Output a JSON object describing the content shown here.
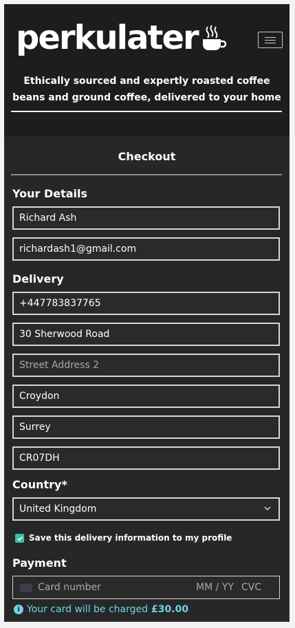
{
  "header": {
    "logo_text": "perkulater",
    "tagline": "Ethically sourced and expertly roasted coffee beans and ground coffee, delivered to your home",
    "icons": {
      "logo": "coffee-cup-icon",
      "menu": "hamburger-menu-icon"
    }
  },
  "checkout": {
    "title": "Checkout"
  },
  "details": {
    "label": "Your Details",
    "full_name": "Richard Ash",
    "email": "richardash1@gmail.com"
  },
  "delivery": {
    "label": "Delivery",
    "phone": "+447783837765",
    "street1": "30 Sherwood Road",
    "street2_placeholder": "Street Address 2",
    "town": "Croydon",
    "county": "Surrey",
    "postcode": "CR07DH"
  },
  "country": {
    "label": "Country*",
    "selected": "United Kingdom"
  },
  "save_info": {
    "label": "Save this delivery information to my profile",
    "checked": true
  },
  "payment": {
    "label": "Payment",
    "card_placeholder": "Card number",
    "exp_placeholder": "MM / YY",
    "cvc_placeholder": "CVC",
    "charge_prefix": "Your card will be charged",
    "charge_amount": "£30.00"
  },
  "colors": {
    "background": "#272727",
    "header": "#1d1d1d",
    "accent": "#3bbfa3",
    "info": "#6fd3e6"
  }
}
